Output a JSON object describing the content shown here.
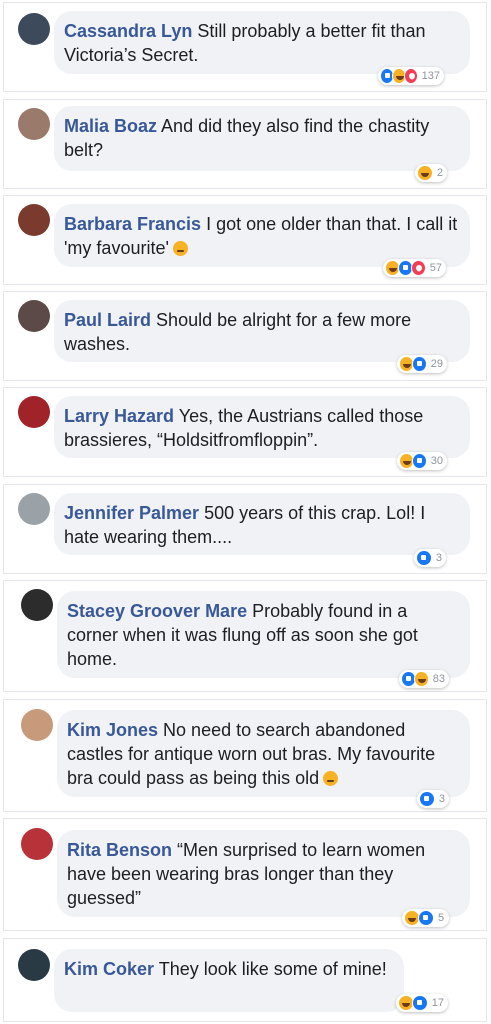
{
  "colors": {
    "name": "#385898",
    "bubble_bg": "#f0f2f5",
    "like": "#1877f2",
    "haha": "#f7b125",
    "love": "#f33e58"
  },
  "comments": [
    {
      "name": "Cassandra Lyn",
      "text": "Still probably a better fit than Victoria’s Secret.",
      "reactions": [
        "like-icon",
        "haha-icon",
        "love-icon"
      ],
      "count": "137",
      "avatar_color": "#3d4a5c"
    },
    {
      "name": "Malia Boaz",
      "text": "And did they also find the chastity belt?",
      "reactions": [
        "haha-icon"
      ],
      "count": "2",
      "avatar_color": "#9a7a6a"
    },
    {
      "name": "Barbara Francis",
      "text": "I got one older than that. I call it 'my favourite'",
      "emoji": "grinning-face-emoji",
      "reactions": [
        "haha-icon",
        "like-icon",
        "love-icon"
      ],
      "count": "57",
      "avatar_color": "#7a3a2e"
    },
    {
      "name": "Paul Laird",
      "text": "Should be alright for a few more washes.",
      "reactions": [
        "haha-icon",
        "like-icon"
      ],
      "count": "29",
      "avatar_color": "#5b4a48"
    },
    {
      "name": "Larry Hazard",
      "text": "Yes, the Austrians called those brassieres, “Holdsitfromfloppin”.",
      "reactions": [
        "haha-icon",
        "like-icon"
      ],
      "count": "30",
      "avatar_color": "#a0232a"
    },
    {
      "name": "Jennifer Palmer",
      "text": "500 years of this crap. Lol! I hate wearing them....",
      "reactions": [
        "like-icon"
      ],
      "count": "3",
      "avatar_color": "#9aa2a8"
    },
    {
      "name": "Stacey Groover Mare",
      "text": "Probably found in a corner when it was flung off as soon she got home.",
      "reactions": [
        "like-icon",
        "haha-icon"
      ],
      "count": "83",
      "avatar_color": "#2c2c2c"
    },
    {
      "name": "Kim Jones",
      "text": "No need to search abandoned castles for antique worn out bras. My favourite bra could pass as being this old",
      "emoji": "grinning-sweat-emoji",
      "reactions": [
        "like-icon"
      ],
      "count": "3",
      "avatar_color": "#c69a7a"
    },
    {
      "name": "Rita Benson",
      "text": "“Men surprised to learn women have been wearing bras longer than they guessed”",
      "reactions": [
        "haha-icon",
        "like-icon"
      ],
      "count": "5",
      "avatar_color": "#b8323a"
    },
    {
      "name": "Kim Coker",
      "text": "They look like some of mine!",
      "reactions": [
        "haha-icon",
        "like-icon"
      ],
      "count": "17",
      "avatar_color": "#2a3a44"
    }
  ]
}
